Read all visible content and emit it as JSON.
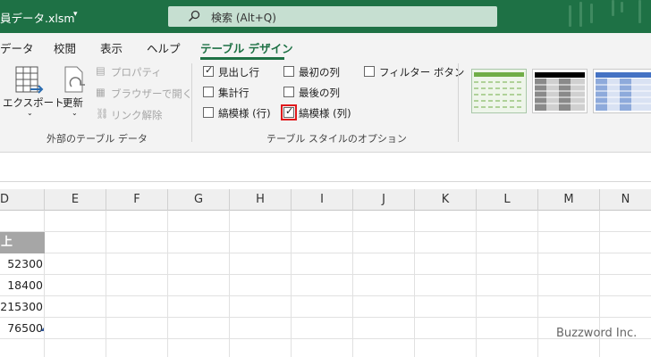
{
  "title": {
    "filename": "員データ.xlsm"
  },
  "search": {
    "placeholder": "検索 (Alt+Q)"
  },
  "menu": {
    "items": [
      {
        "label": "データ"
      },
      {
        "label": "校閲"
      },
      {
        "label": "表示"
      },
      {
        "label": "ヘルプ"
      },
      {
        "label": "テーブル デザイン"
      }
    ],
    "active": "テーブル デザイン"
  },
  "ribbon": {
    "external": {
      "export_label": "エクスポート",
      "refresh_label": "更新",
      "properties_label": "プロパティ",
      "browser_label": "ブラウザーで開く",
      "unlink_label": "リンク解除",
      "group_label": "外部のテーブル データ"
    },
    "style_options": {
      "header_row": {
        "label": "見出し行",
        "checked": true
      },
      "total_row": {
        "label": "集計行",
        "checked": false
      },
      "banded_rows": {
        "label": "縞模様 (行)",
        "checked": false
      },
      "first_column": {
        "label": "最初の列",
        "checked": false
      },
      "last_column": {
        "label": "最後の列",
        "checked": false
      },
      "banded_columns": {
        "label": "縞模様 (列)",
        "checked": true
      },
      "filter_button": {
        "label": "フィルター ボタン",
        "checked": false
      },
      "group_label": "テーブル スタイルのオプション"
    },
    "styles_gallery": {
      "accent_colors": [
        "#70ad47",
        "#000000",
        "#4472c4"
      ]
    }
  },
  "grid": {
    "columns": [
      "D",
      "E",
      "F",
      "G",
      "H",
      "I",
      "J",
      "K",
      "L",
      "M",
      "N"
    ],
    "header_cell": "上",
    "values": [
      "52300",
      "18400",
      "215300",
      "76500"
    ]
  },
  "watermark": "Buzzword Inc."
}
